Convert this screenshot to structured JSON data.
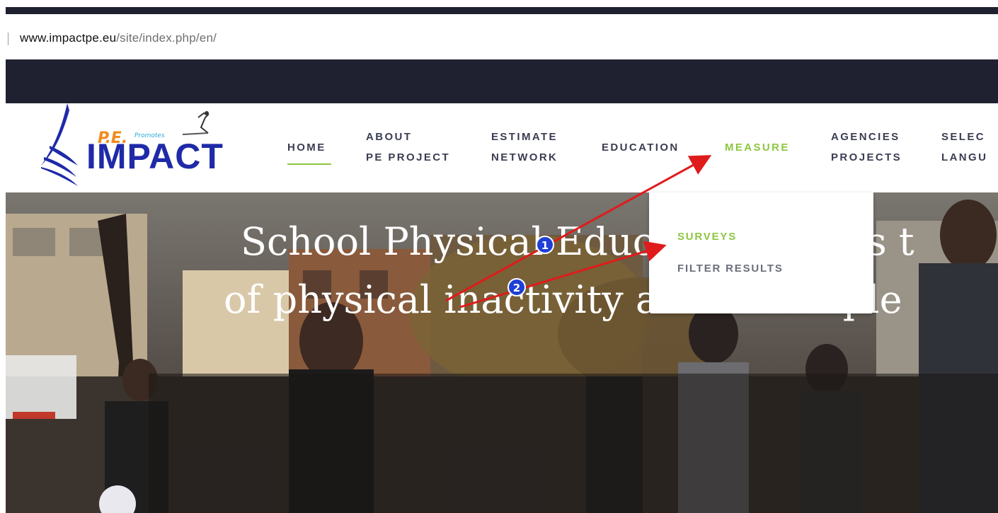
{
  "browser": {
    "url_domain": "www.impactpe.eu",
    "url_path": "/site/index.php/en/"
  },
  "logo": {
    "brand": "IMPACT",
    "prefix": "P.E.",
    "tagline": "Promotes"
  },
  "nav": {
    "home": "HOME",
    "about_line1": "ABOUT",
    "about_line2": "PE PROJECT",
    "estimate_line1": "ESTIMATE",
    "estimate_line2": "NETWORK",
    "education": "EDUCATION",
    "measure": "MEASURE",
    "agencies_line1": "AGENCIES",
    "agencies_line2": "PROJECTS",
    "select_line1": "SELEC",
    "select_line2": "LANGU"
  },
  "dropdown": {
    "items": [
      "SURVEYS",
      "FILTER RESULTS"
    ]
  },
  "hero": {
    "line1": "School Physical Education allows t",
    "line2": "of physical inactivity and the imple"
  },
  "annotations": {
    "markers": [
      "1",
      "2"
    ]
  },
  "colors": {
    "accent_green": "#8cc63f",
    "nav_text": "#3a3d52",
    "dark_band": "#1f2130",
    "logo_blue": "#1f2aa8",
    "arrow_red": "#e01b1b",
    "marker_blue": "#1f3fd6"
  }
}
